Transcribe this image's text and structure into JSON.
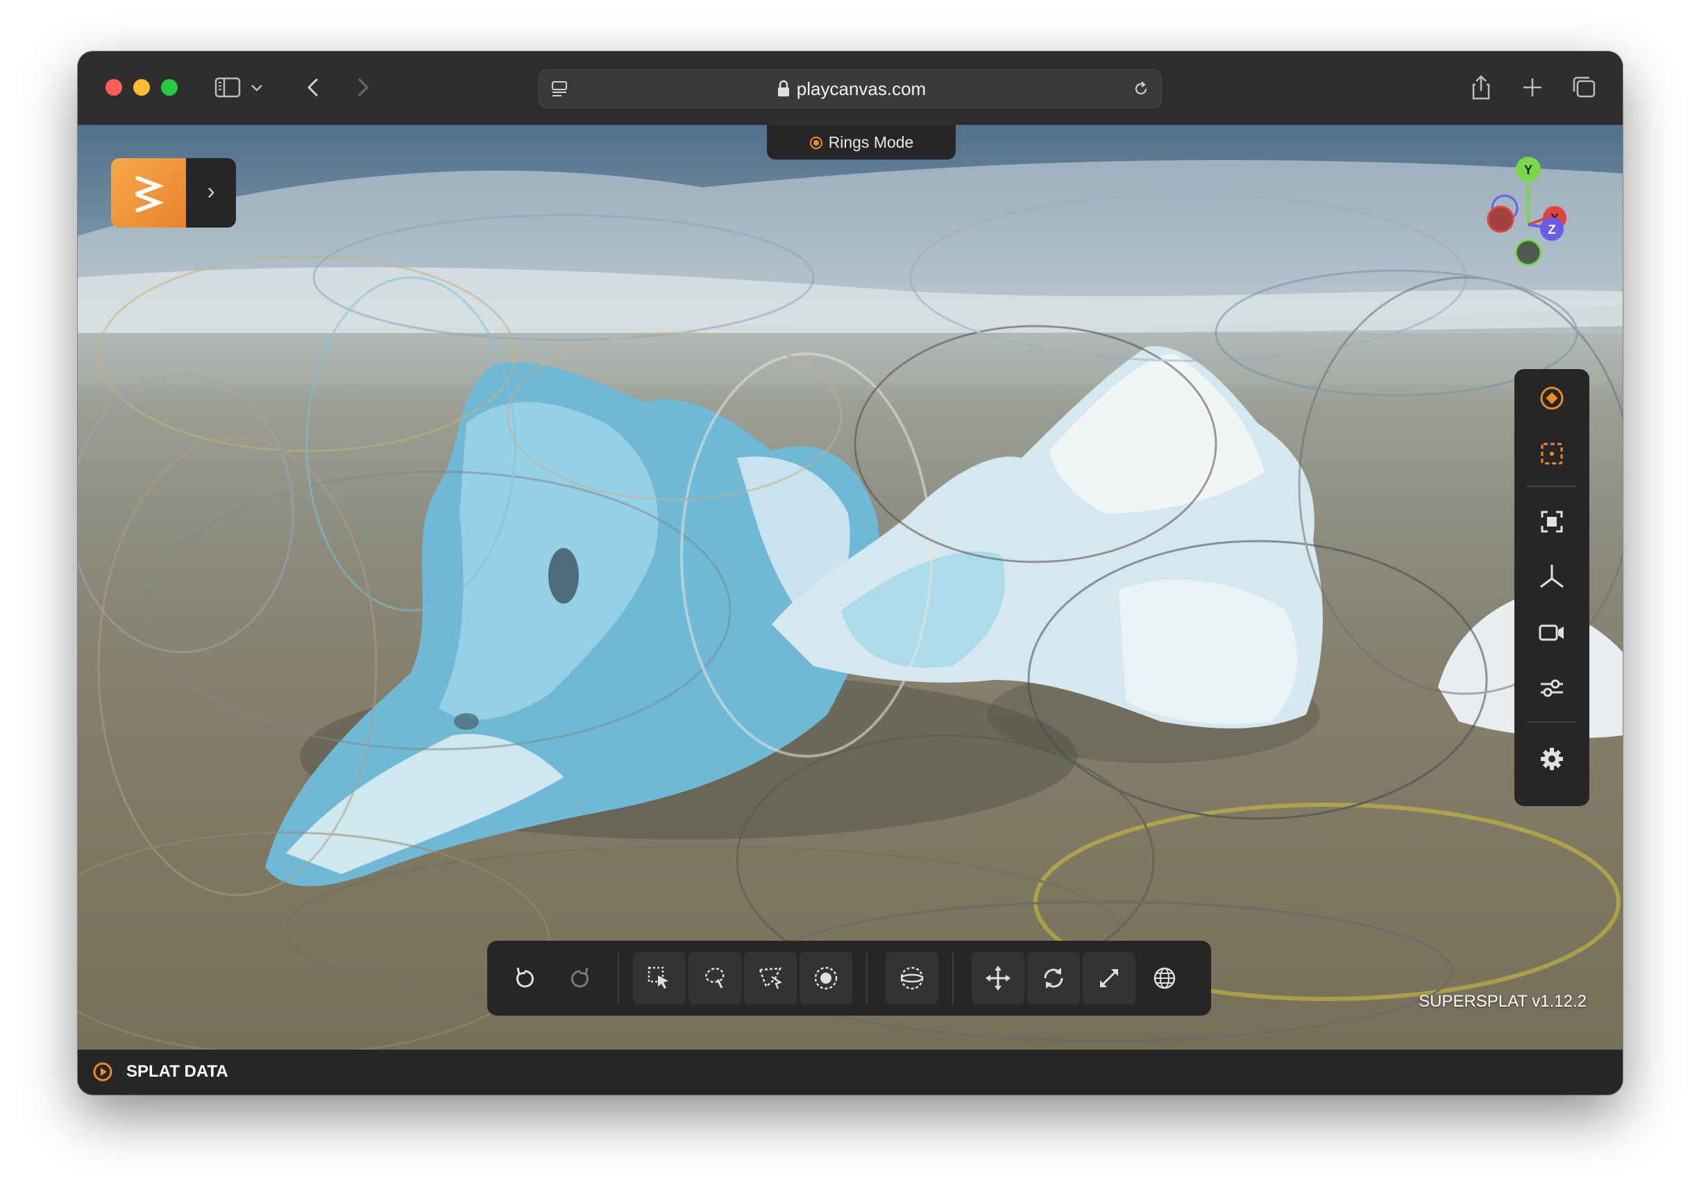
{
  "browser": {
    "url": "playcanvas.com"
  },
  "app": {
    "mode_label": "Rings Mode",
    "version": "SUPERSPLAT v1.12.2",
    "status_label": "SPLAT DATA",
    "accent_color": "#f08a2c"
  },
  "gizmo": {
    "axes": [
      "Y",
      "X",
      "Z"
    ],
    "colors": {
      "Y": "#7ad64a",
      "X": "#e0443f",
      "Z": "#6b5ce7"
    }
  },
  "right_toolbar": {
    "items": [
      "rings-mode-icon",
      "centers-mode-icon",
      "frame-selection-icon",
      "axes-icon",
      "camera-icon",
      "sliders-icon",
      "settings-icon"
    ]
  },
  "bottom_toolbar": {
    "items": [
      "undo-icon",
      "redo-icon",
      "rect-select-icon",
      "lasso-select-icon",
      "polygon-select-icon",
      "brush-select-icon",
      "sphere-select-icon",
      "move-icon",
      "rotate-icon",
      "scale-icon",
      "world-space-icon"
    ]
  }
}
